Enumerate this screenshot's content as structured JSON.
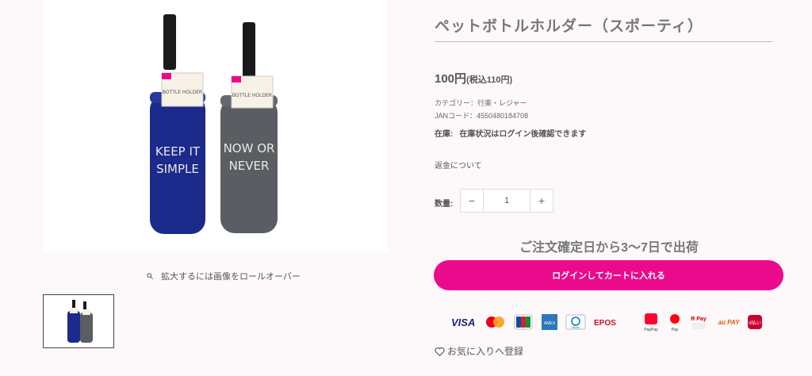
{
  "product": {
    "title": "ペットボトルホルダー（スポーティ）",
    "price": "100円",
    "price_tax": "(税込110円)",
    "category": "カテゴリー：行楽・レジャー",
    "jan": "JANコード：4550480184708",
    "stock_label": "在庫:",
    "stock_text": "在庫状況はログイン後確認できます",
    "refund_link": "返金について"
  },
  "gallery": {
    "zoom_hint": "拡大するには画像をロールオーバー",
    "holders": [
      {
        "text_line1": "KEEP IT",
        "text_line2": "SIMPLE",
        "color": "#1c2a8c"
      },
      {
        "text_line1": "NOW OR",
        "text_line2": "NEVER",
        "color": "#5a5d62"
      }
    ],
    "tag_text": "BOTTLE HOLDER"
  },
  "quantity": {
    "label": "数量:",
    "minus": "−",
    "value": "1",
    "plus": "+"
  },
  "shipping_note": "ご注文確定日から3〜7日で出荷",
  "cart_button": "ログインしてカートに入れる",
  "payments": {
    "visa": "VISA",
    "mastercard": "mastercard",
    "jcb": "JCB",
    "amex": "AMEX",
    "diners": "Diners",
    "epos": "EPOS",
    "paypay": "PayPay",
    "merpay": "Pay",
    "rpay": "R Pay",
    "aupay": "au PAY",
    "dbarai": "d払い"
  },
  "favorite": "お気に入りへ登録",
  "colors": {
    "accent": "#ec0a8c"
  }
}
